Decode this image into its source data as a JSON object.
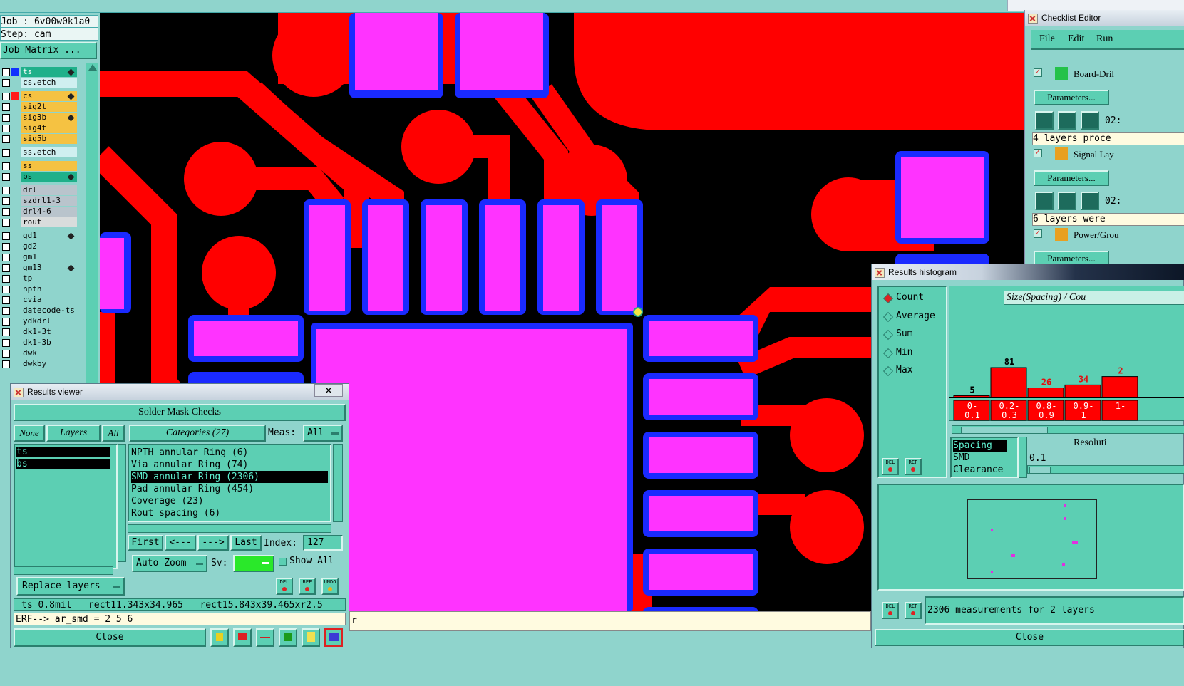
{
  "job_panel": {
    "job": "Job : 6v00w0k1a0",
    "step": "Step: cam",
    "job_matrix": "Job Matrix ..."
  },
  "layers": [
    {
      "name": "ts",
      "color": "#1fb08a",
      "swatch": "#1030ff",
      "board": true
    },
    {
      "name": "cs.etch",
      "color": "#cfeff0",
      "swatch": "",
      "board": false
    },
    {
      "name": "cs",
      "color": "#f5c242",
      "swatch": "#ff1a1a",
      "board": true
    },
    {
      "name": "sig2t",
      "color": "#f5c242",
      "swatch": "",
      "board": false
    },
    {
      "name": "sig3b",
      "color": "#f5c242",
      "swatch": "",
      "board": true
    },
    {
      "name": "sig4t",
      "color": "#f5c242",
      "swatch": "",
      "board": false
    },
    {
      "name": "sig5b",
      "color": "#f5c242",
      "swatch": "",
      "board": false
    },
    {
      "name": "ss.etch",
      "color": "#cfeff0",
      "swatch": "",
      "board": false
    },
    {
      "name": "ss",
      "color": "#f5c242",
      "swatch": "",
      "board": false
    },
    {
      "name": "bs",
      "color": "#1fb08a",
      "swatch": "",
      "board": true
    },
    {
      "name": "drl",
      "color": "#b9c4cc",
      "swatch": "",
      "board": false
    },
    {
      "name": "szdrl1-3",
      "color": "#b9c4cc",
      "swatch": "",
      "board": false
    },
    {
      "name": "drl4-6",
      "color": "#b9c4cc",
      "swatch": "",
      "board": false
    },
    {
      "name": "rout",
      "color": "#d9dcdc",
      "swatch": "",
      "board": false
    },
    {
      "name": "gd1",
      "color": "#8fd4cc",
      "swatch": "",
      "board": true
    },
    {
      "name": "gd2",
      "color": "#8fd4cc",
      "swatch": "",
      "board": false
    },
    {
      "name": "gm1",
      "color": "#8fd4cc",
      "swatch": "",
      "board": false
    },
    {
      "name": "gm13",
      "color": "#8fd4cc",
      "swatch": "",
      "board": true
    },
    {
      "name": "tp",
      "color": "#8fd4cc",
      "swatch": "",
      "board": false
    },
    {
      "name": "npth",
      "color": "#8fd4cc",
      "swatch": "",
      "board": false
    },
    {
      "name": "cvia",
      "color": "#8fd4cc",
      "swatch": "",
      "board": false
    },
    {
      "name": "datecode-ts",
      "color": "#8fd4cc",
      "swatch": "",
      "board": false
    },
    {
      "name": "ydkdrl",
      "color": "#8fd4cc",
      "swatch": "",
      "board": false
    },
    {
      "name": "dk1-3t",
      "color": "#8fd4cc",
      "swatch": "",
      "board": false
    },
    {
      "name": "dk1-3b",
      "color": "#8fd4cc",
      "swatch": "",
      "board": false
    },
    {
      "name": "dwk",
      "color": "#8fd4cc",
      "swatch": "",
      "board": false
    },
    {
      "name": "dwkby",
      "color": "#8fd4cc",
      "swatch": "",
      "board": false
    }
  ],
  "colors": {
    "canvas": "#000000",
    "copper": "#ff0000",
    "pad": "#ff33ff",
    "mask": "#1a2aff",
    "teal": "#5ccfb3",
    "teal_light": "#8fd4cc"
  },
  "results_viewer": {
    "title": "Results viewer",
    "header": "Solder Mask Checks",
    "none_label": "None",
    "layers_label": "Layers",
    "all_label": "All",
    "categories_label": "Categories (27)",
    "meas_label": "Meas:",
    "meas_value": "All",
    "layer_items": [
      "ts",
      "bs"
    ],
    "categories": [
      {
        "label": "NPTH annular Ring (6)",
        "selected": false
      },
      {
        "label": "Via annular Ring (74)",
        "selected": false
      },
      {
        "label": "SMD annular Ring (2306)",
        "selected": true
      },
      {
        "label": "Pad annular Ring (454)",
        "selected": false
      },
      {
        "label": "Coverage (23)",
        "selected": false
      },
      {
        "label": "Rout spacing (6)",
        "selected": false
      }
    ],
    "first": "First",
    "prev": "<---",
    "next": "--->",
    "last": "Last",
    "index_label": "Index:",
    "index_value": "127",
    "auto_zoom": "Auto Zoom",
    "sv_label": "Sv:",
    "show_all": "Show All",
    "replace_layers": "Replace layers",
    "status": "ts 0.8mil   rect11.343x34.965   rect15.843x39.465xr2.5",
    "erf": "ERF--> ar_smd = 2 5 6",
    "close": "Close",
    "del": "DEL",
    "ref": "REF",
    "undo": "UNDO"
  },
  "command_line_text": "r",
  "checklist": {
    "title": "Checklist Editor",
    "menu": [
      "File",
      "Edit",
      "Run"
    ],
    "items": [
      {
        "name": "Board-Dril",
        "params": "Parameters...",
        "time": "02:",
        "msg": "4 layers proce"
      },
      {
        "name": "Signal Lay",
        "params": "Parameters...",
        "time": "02:",
        "msg": "6 layers were"
      },
      {
        "name": "Power/Grou",
        "params": "Parameters...",
        "time": "",
        "msg": ""
      }
    ]
  },
  "histogram": {
    "title": "Results histogram",
    "modes": [
      {
        "label": "Count",
        "selected": true
      },
      {
        "label": "Average",
        "selected": false
      },
      {
        "label": "Sum",
        "selected": false
      },
      {
        "label": "Min",
        "selected": false
      },
      {
        "label": "Max",
        "selected": false
      }
    ],
    "chart_title": "Size(Spacing) / Cou",
    "bars": [
      {
        "label1": "0-",
        "label2": "0.1",
        "value": 5,
        "value_text": "5"
      },
      {
        "label1": "0.2-",
        "label2": "0.3",
        "value": 81,
        "value_text": "81"
      },
      {
        "label1": "0.8-",
        "label2": "0.9",
        "value": 26,
        "value_text": "26"
      },
      {
        "label1": "0.9-",
        "label2": "1",
        "value": 34,
        "value_text": "34"
      },
      {
        "label1": "1-",
        "label2": "",
        "value": null,
        "value_text": "2"
      }
    ],
    "types": [
      "Spacing",
      "SMD",
      "Clearance"
    ],
    "resolution_label": "Resoluti",
    "resolution_value": "0.1",
    "summary": "2306 measurements for 2 layers",
    "close": "Close",
    "del": "DEL",
    "ref": "REF"
  }
}
